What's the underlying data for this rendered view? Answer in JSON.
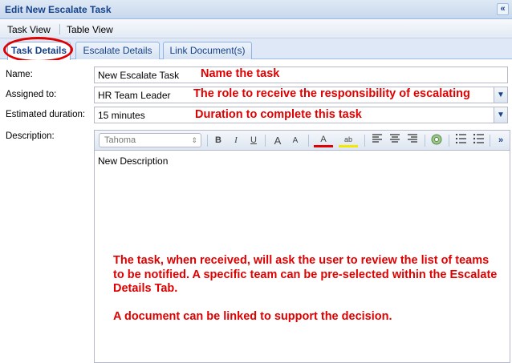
{
  "window": {
    "title": "Edit New Escalate Task",
    "collapse_glyph": "«"
  },
  "menubar": {
    "items": [
      "Task View",
      "Table View"
    ]
  },
  "tabs": [
    {
      "label": "Task Details",
      "active": true
    },
    {
      "label": "Escalate Details",
      "active": false
    },
    {
      "label": "Link Document(s)",
      "active": false
    }
  ],
  "form": {
    "name": {
      "label": "Name:",
      "value": "New Escalate Task",
      "annotation": "Name the task"
    },
    "assigned_to": {
      "label": "Assigned to:",
      "value": "HR Team Leader",
      "annotation": "The role to receive the responsibility of escalating"
    },
    "estimated_duration": {
      "label": "Estimated duration:",
      "value": "15 minutes",
      "annotation": "Duration to complete this task"
    },
    "description": {
      "label": "Description:",
      "font": "Tahoma",
      "content": "New Description",
      "note": [
        "The task, when received, will ask the user to review the list of teams to be notified.  A specific team can be pre-selected within the Escalate Details Tab.",
        "A document can be linked to support the decision."
      ]
    }
  },
  "toolbar": {
    "bold": "B",
    "italic": "I",
    "underline": "U",
    "grow": "A",
    "shrink": "A",
    "font_color": "A",
    "highlight": "ab",
    "more": "»"
  },
  "colors": {
    "accent": "#15428b",
    "annotation": "#e00000",
    "border": "#99bbe8"
  },
  "icons": [
    "collapse-icon",
    "dropdown-arrow-icon",
    "align-left-icon",
    "align-center-icon",
    "align-right-icon",
    "link-icon",
    "ordered-list-icon",
    "unordered-list-icon",
    "source-edit-icon"
  ]
}
